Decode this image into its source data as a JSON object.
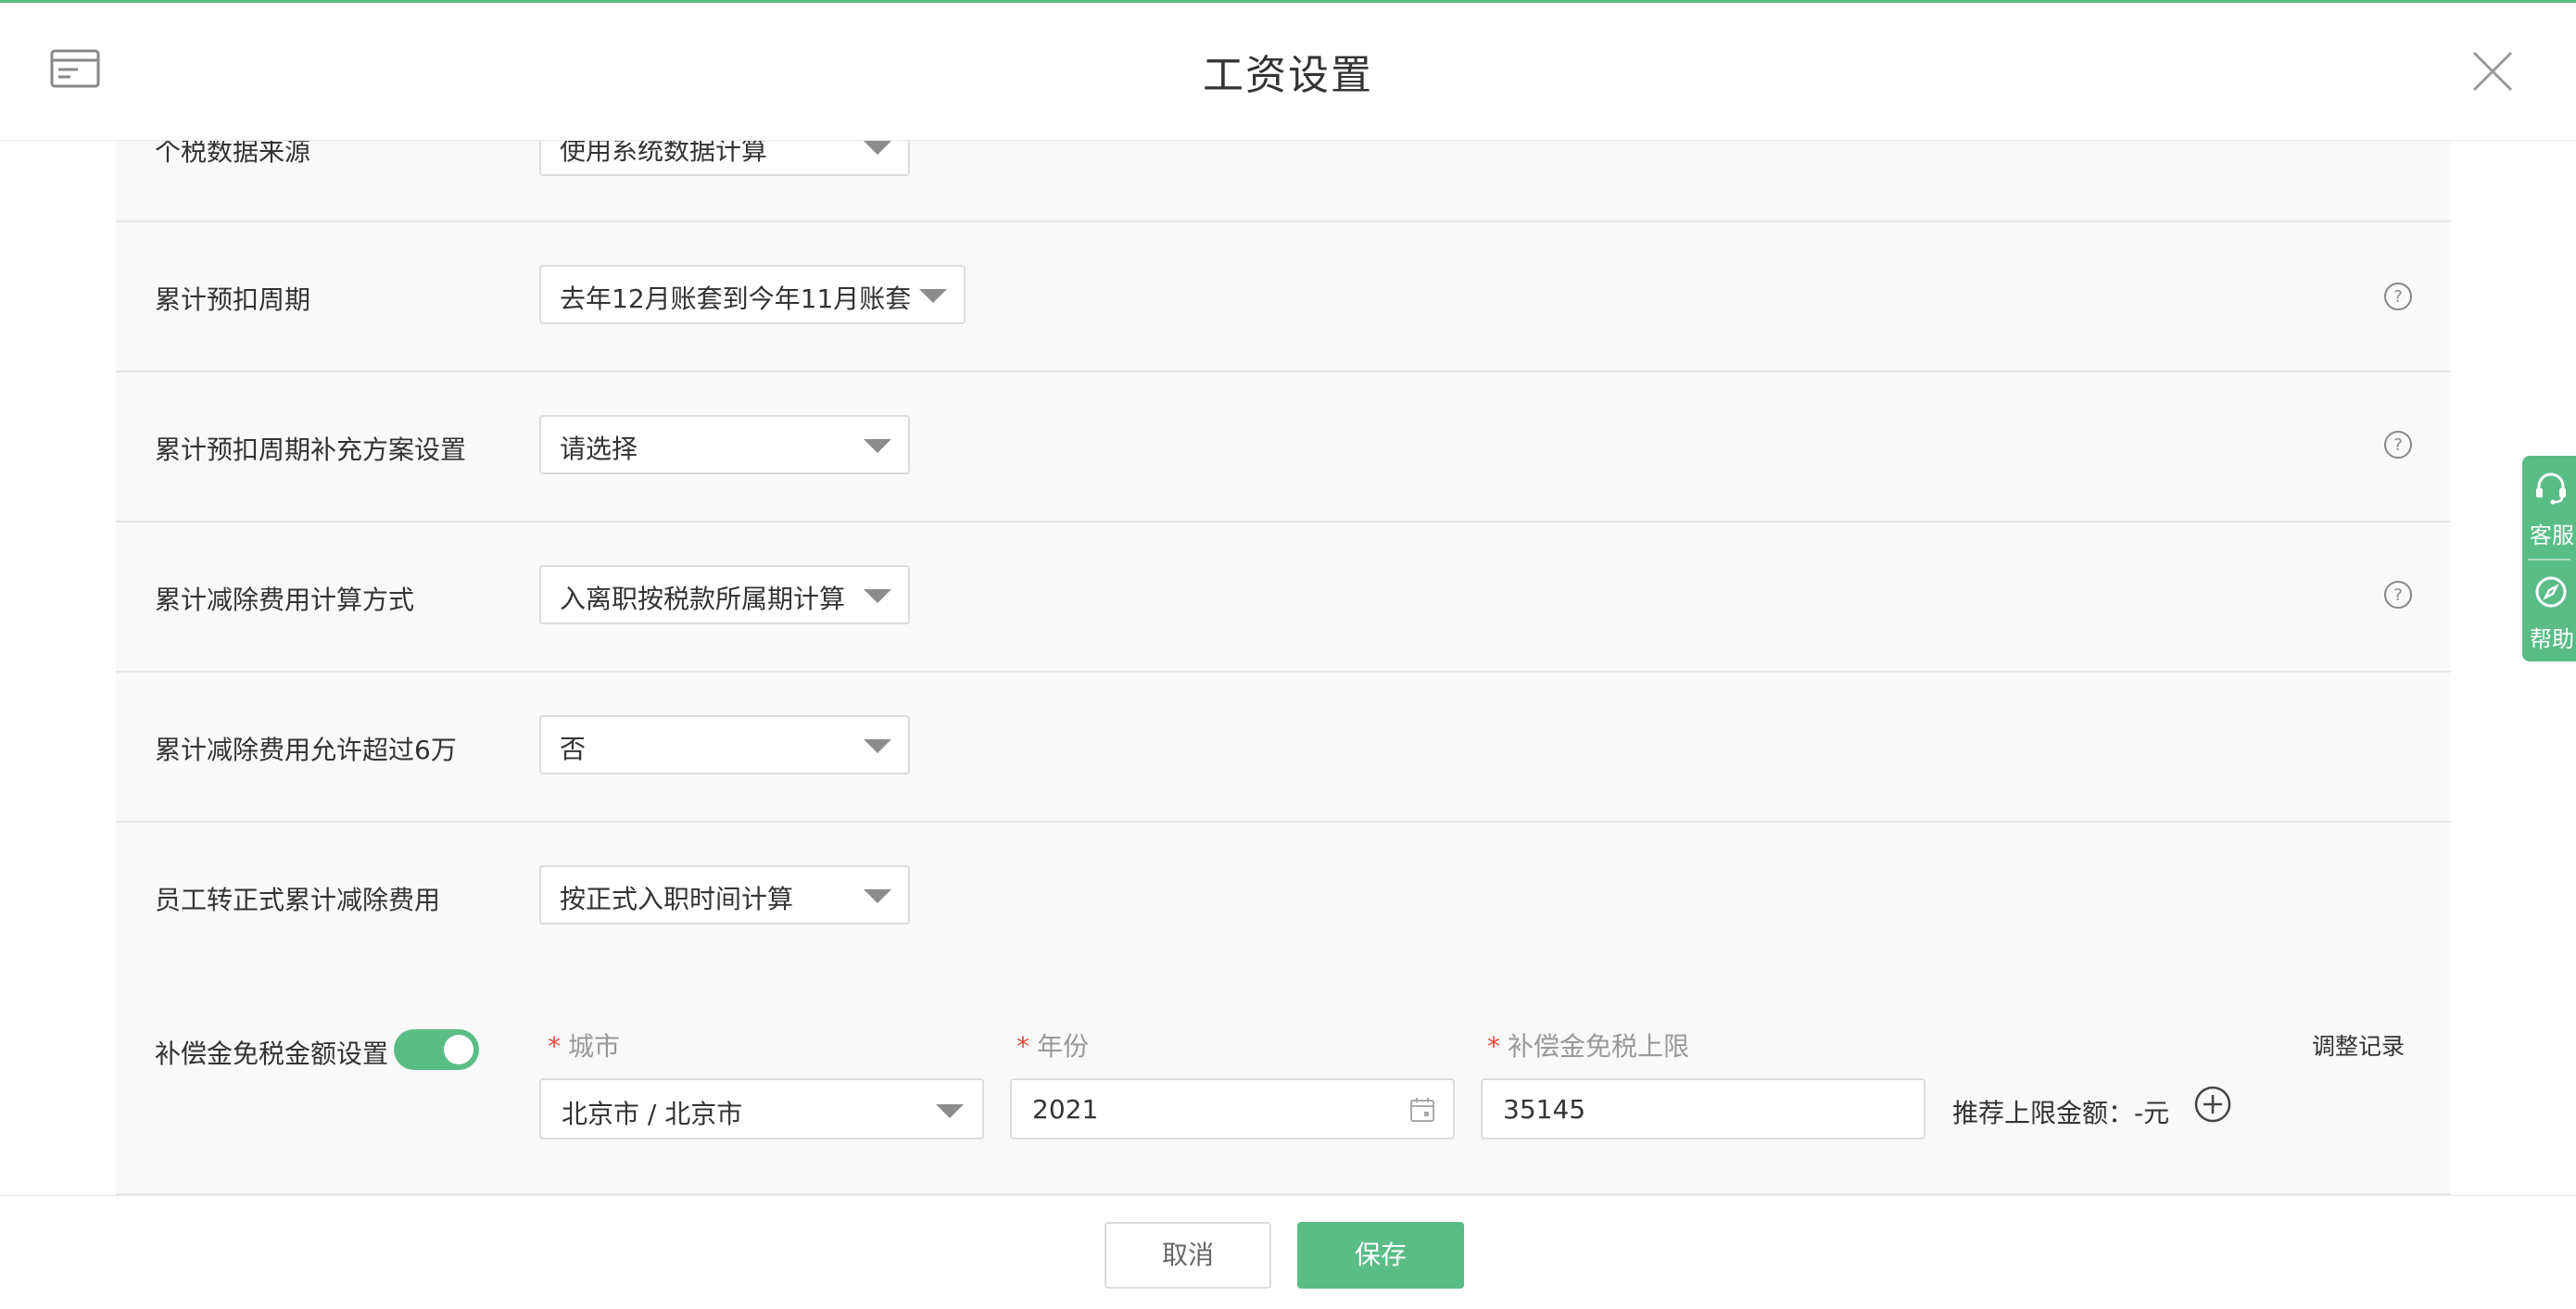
{
  "header": {
    "title": "工资设置",
    "icon": "card-icon",
    "close_icon": "close-icon"
  },
  "rows": [
    {
      "label": "个税数据来源",
      "select_value": "使用系统数据计算",
      "help": false
    },
    {
      "label": "累计预扣周期",
      "select_value": "去年12月账套到今年11月账套",
      "help": true
    },
    {
      "label": "累计预扣周期补充方案设置",
      "select_value": "请选择",
      "help": true
    },
    {
      "label": "累计减除费用计算方式",
      "select_value": "入离职按税款所属期计算",
      "help": true
    },
    {
      "label": "累计减除费用允许超过6万",
      "select_value": "否",
      "help": false
    },
    {
      "label": "员工转正式累计减除费用",
      "select_value": "按正式入职时间计算",
      "help": false
    }
  ],
  "compensation": {
    "label": "补偿金免税金额设置",
    "toggle_on": true,
    "required_mark": "*",
    "city_label": "城市",
    "city_value": "北京市 / 北京市",
    "year_label": "年份",
    "year_value": "2021",
    "limit_label": "补偿金免税上限",
    "limit_value": "35145",
    "recommend_text": "推荐上限金额：-元",
    "adjust_link": "调整记录"
  },
  "footer": {
    "cancel_label": "取消",
    "save_label": "保存"
  },
  "side_panel": {
    "service_label": "客服",
    "help_label": "帮助"
  },
  "colors": {
    "accent": "#5bbd86",
    "required": "#e84a3b",
    "border": "#dcdcdc",
    "row_bg": "#f9f9f9"
  }
}
